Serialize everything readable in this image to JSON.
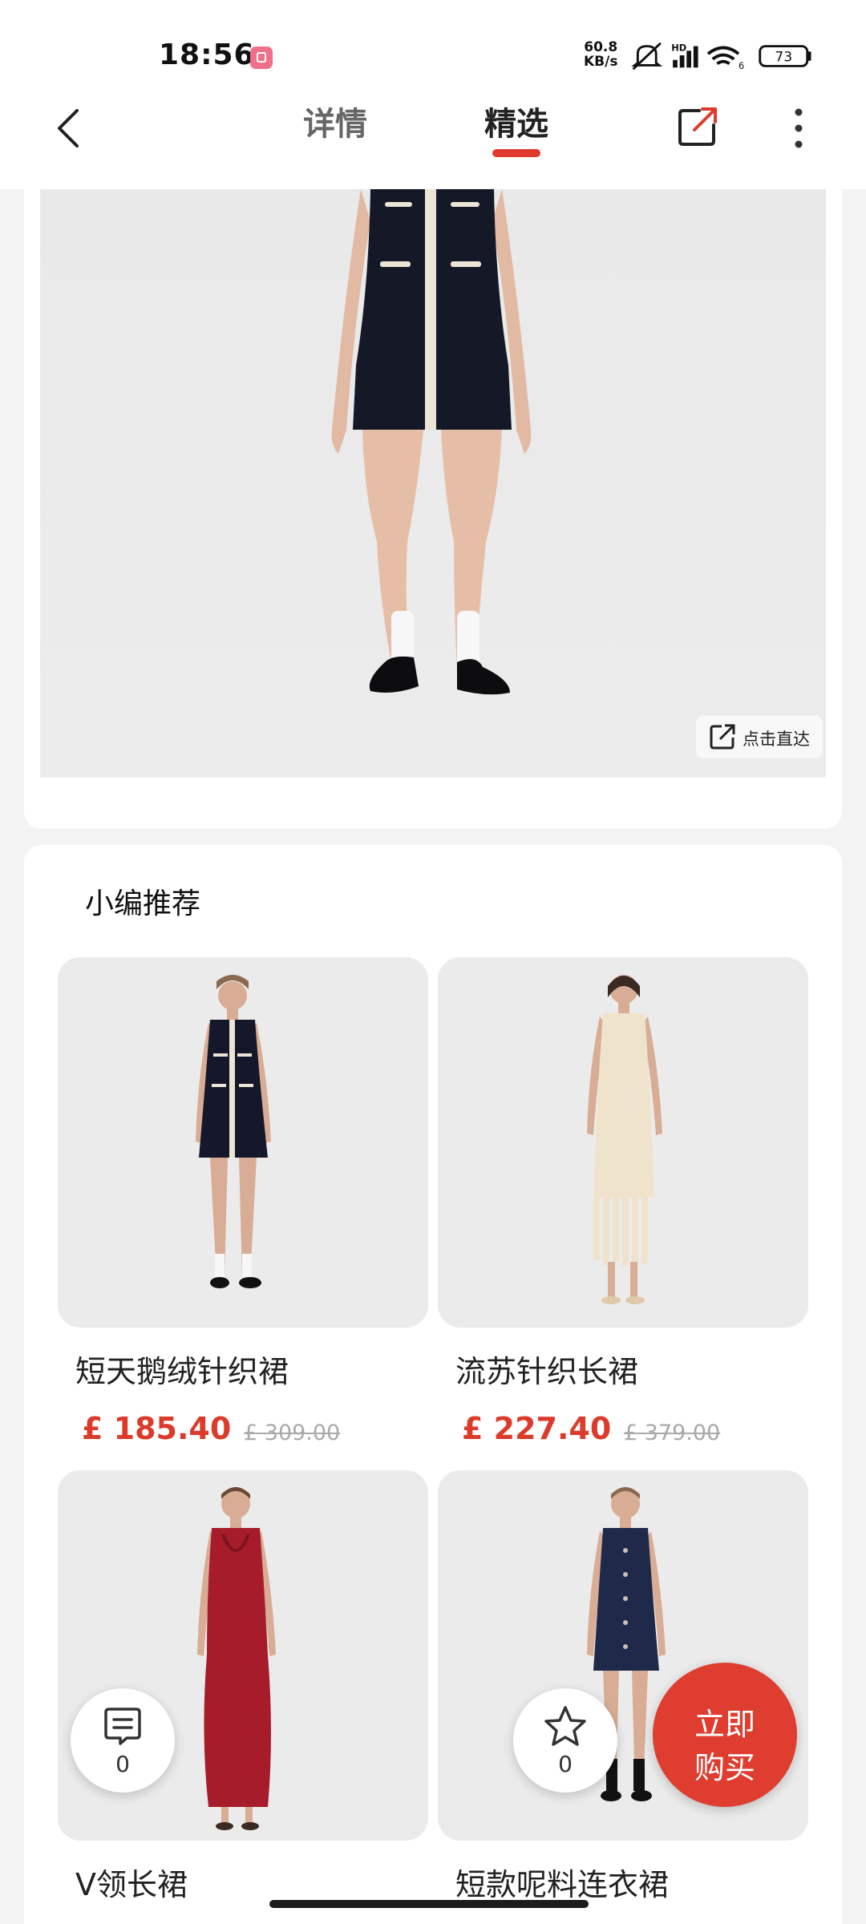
{
  "status_bar": {
    "time": "18:56",
    "net_speed_value": "60.8",
    "net_speed_unit": "KB/s",
    "signal_label": "HD",
    "wifi_label": "6",
    "battery": "73"
  },
  "nav": {
    "tabs": [
      {
        "label": "详情",
        "active": false
      },
      {
        "label": "精选",
        "active": true
      }
    ],
    "accent_color": "#e03a2e"
  },
  "hero": {
    "jump_label": "点击直达"
  },
  "recommend": {
    "title": "小编推荐",
    "products": [
      {
        "name": "短天鹅绒针织裙",
        "price": "£ 185.40",
        "original_price": "£ 309.00",
        "dress_color": "#15182b"
      },
      {
        "name": "流苏针织长裙",
        "price": "£ 227.40",
        "original_price": "£ 379.00",
        "dress_color": "#efe3cc"
      },
      {
        "name": "V领长裙",
        "price": "",
        "original_price": "",
        "dress_color": "#a61c2a"
      },
      {
        "name": "短款呢料连衣裙",
        "price": "",
        "original_price": "",
        "dress_color": "#1f2a4a"
      }
    ]
  },
  "floating": {
    "comments_count": "0",
    "favorites_count": "0",
    "buy_line1": "立即",
    "buy_line2": "购买",
    "buy_color": "#de3d2f"
  }
}
